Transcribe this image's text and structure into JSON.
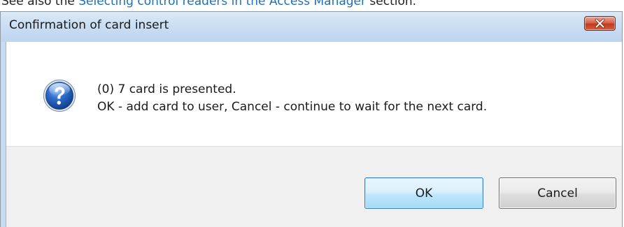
{
  "doc_context": {
    "prefix": "See also the ",
    "link": "Selecting control readers in the Access Manager",
    "suffix": " section."
  },
  "dialog": {
    "title": "Confirmation of card insert",
    "close_icon": "close-icon",
    "message_icon": "question-icon",
    "message_line1": "(0) 7 card is presented.",
    "message_line2": "OK - add card to user, Cancel - continue to wait for the next card.",
    "ok_label": "OK",
    "cancel_label": "Cancel"
  },
  "colors": {
    "titlebar": "#cadef3",
    "close_button": "#c7432a",
    "ok_border": "#3c7fb1",
    "footer": "#f0f0f0",
    "link": "#1f6fb2"
  }
}
